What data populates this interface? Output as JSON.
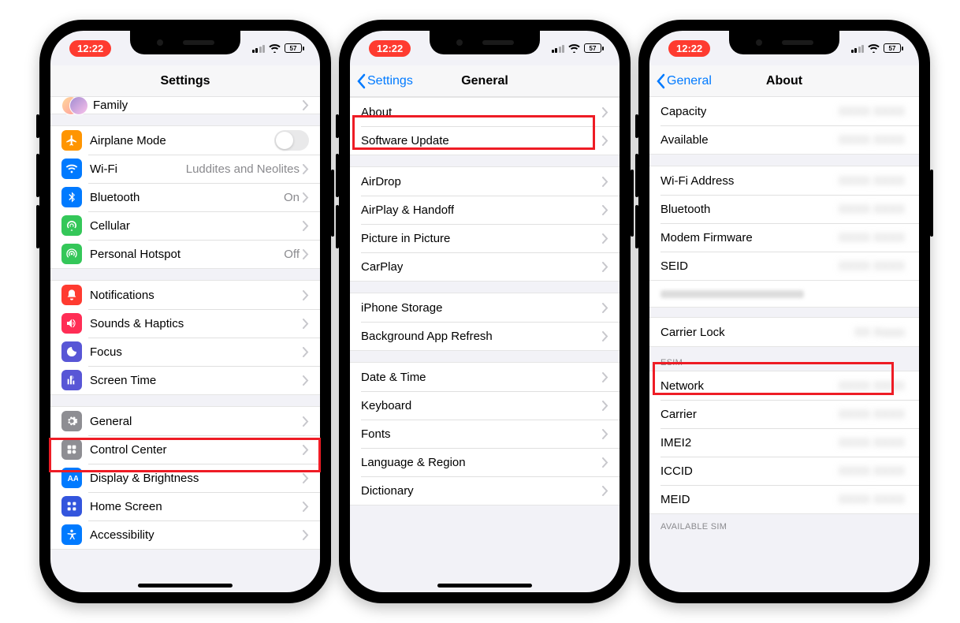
{
  "status": {
    "time": "12:22",
    "battery": "57"
  },
  "screens": {
    "settings": {
      "title": "Settings",
      "family_label": "Family",
      "g1": [
        {
          "key": "airplane",
          "label": "Airplane Mode",
          "color": "#ff9500",
          "switch": true
        },
        {
          "key": "wifi",
          "label": "Wi-Fi",
          "value": "Luddites and Neolites",
          "color": "#007aff"
        },
        {
          "key": "bluetooth",
          "label": "Bluetooth",
          "value": "On",
          "color": "#007aff"
        },
        {
          "key": "cellular",
          "label": "Cellular",
          "color": "#34c759"
        },
        {
          "key": "hotspot",
          "label": "Personal Hotspot",
          "value": "Off",
          "color": "#34c759"
        }
      ],
      "g2": [
        {
          "key": "notifications",
          "label": "Notifications",
          "color": "#ff3b30"
        },
        {
          "key": "sounds",
          "label": "Sounds & Haptics",
          "color": "#ff2d55"
        },
        {
          "key": "focus",
          "label": "Focus",
          "color": "#5856d6"
        },
        {
          "key": "screentime",
          "label": "Screen Time",
          "color": "#5856d6"
        }
      ],
      "g3": [
        {
          "key": "general",
          "label": "General",
          "color": "#8e8e93"
        },
        {
          "key": "controlcenter",
          "label": "Control Center",
          "color": "#8e8e93"
        },
        {
          "key": "display",
          "label": "Display & Brightness",
          "color": "#007aff"
        },
        {
          "key": "homescreen",
          "label": "Home Screen",
          "color": "#3355dd"
        },
        {
          "key": "accessibility",
          "label": "Accessibility",
          "color": "#007aff"
        }
      ]
    },
    "general": {
      "back": "Settings",
      "title": "General",
      "g1": [
        "About",
        "Software Update"
      ],
      "g2": [
        "AirDrop",
        "AirPlay & Handoff",
        "Picture in Picture",
        "CarPlay"
      ],
      "g3": [
        "iPhone Storage",
        "Background App Refresh"
      ],
      "g4": [
        "Date & Time",
        "Keyboard",
        "Fonts",
        "Language & Region",
        "Dictionary"
      ]
    },
    "about": {
      "back": "General",
      "title": "About",
      "g1": [
        {
          "label": "Capacity"
        },
        {
          "label": "Available"
        }
      ],
      "g2": [
        {
          "label": "Wi-Fi Address"
        },
        {
          "label": "Bluetooth"
        },
        {
          "label": "Modem Firmware"
        },
        {
          "label": "SEID"
        }
      ],
      "carrier_lock_label": "Carrier Lock",
      "esim_header": "ESIM",
      "g3": [
        {
          "label": "Network"
        },
        {
          "label": "Carrier"
        },
        {
          "label": "IMEI2"
        },
        {
          "label": "ICCID"
        },
        {
          "label": "MEID"
        }
      ],
      "avail_sim_header": "AVAILABLE SIM"
    }
  }
}
